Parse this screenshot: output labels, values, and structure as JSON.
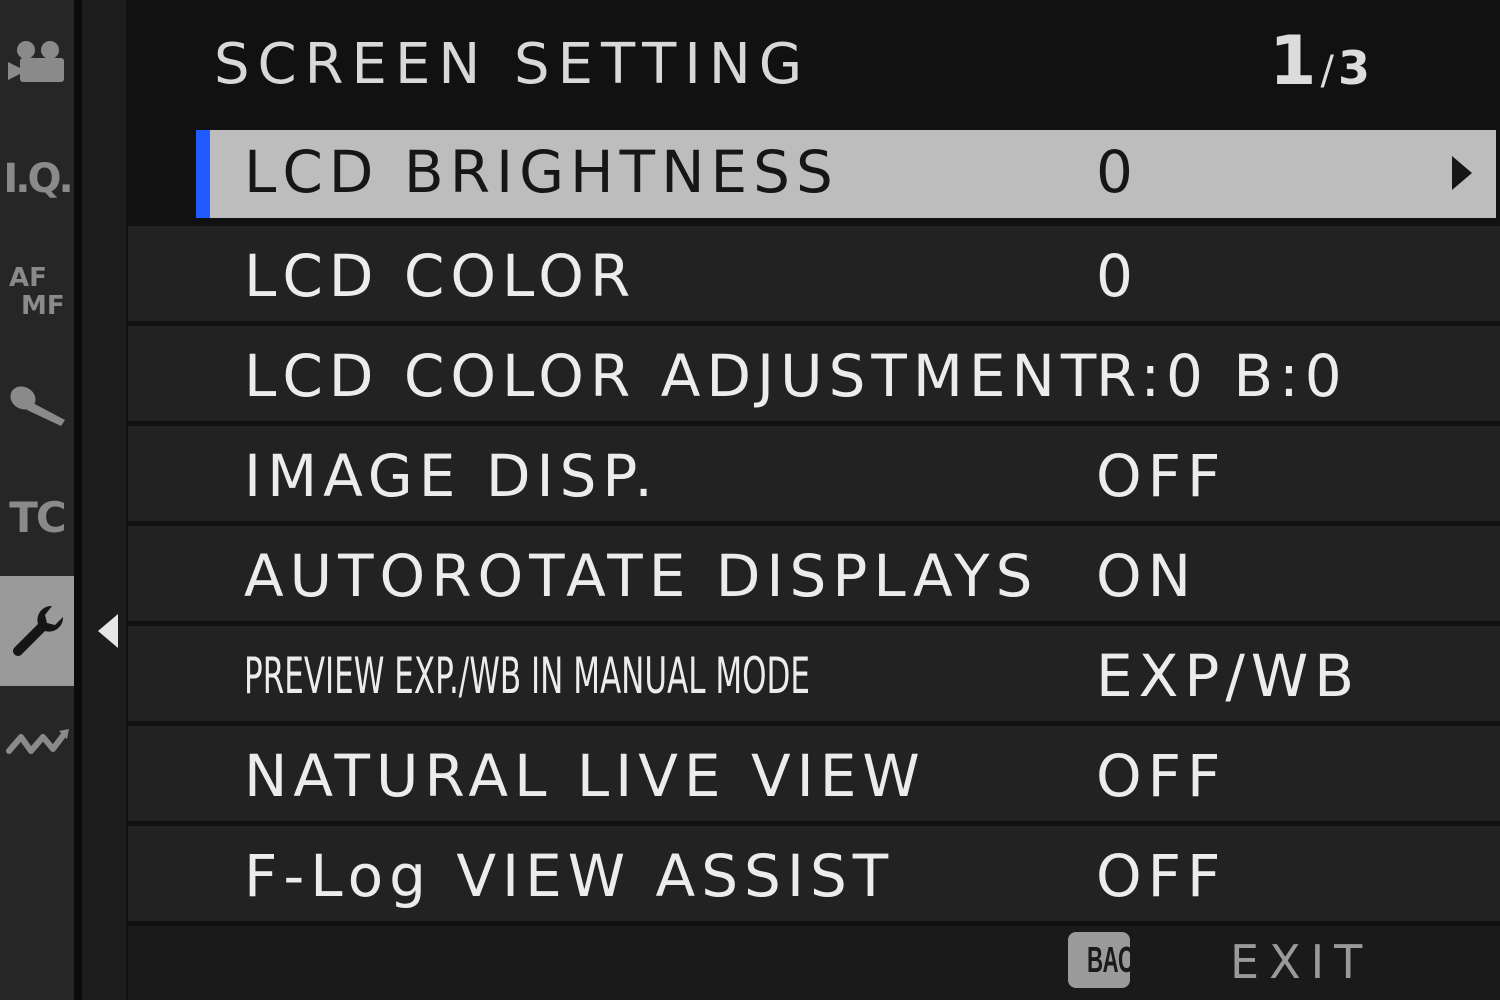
{
  "sidebar": {
    "items": [
      {
        "icon": "movie-camera-icon",
        "text": ""
      },
      {
        "icon": "image-quality-icon",
        "text": "I.Q."
      },
      {
        "icon": "focus-mode-icon",
        "text_top": "AF",
        "text_bottom": "MF"
      },
      {
        "icon": "microphone-icon",
        "text": ""
      },
      {
        "icon": "timecode-icon",
        "text": "TC"
      },
      {
        "icon": "wrench-icon",
        "text": "",
        "active": true
      },
      {
        "icon": "squiggle-icon",
        "text": ""
      }
    ]
  },
  "header": {
    "title": "SCREEN SETTING",
    "page_current": "1",
    "page_separator": "/",
    "page_total": "3"
  },
  "menu": {
    "items": [
      {
        "label": "LCD BRIGHTNESS",
        "value": "0",
        "selected": true
      },
      {
        "label": "LCD COLOR",
        "value": "0"
      },
      {
        "label": "LCD COLOR ADJUSTMENT",
        "value": "R:0 B:0"
      },
      {
        "label": "IMAGE DISP.",
        "value": "OFF"
      },
      {
        "label": "AUTOROTATE DISPLAYS",
        "value": "ON"
      },
      {
        "label": "PREVIEW EXP./WB IN MANUAL MODE",
        "value": "EXP/WB"
      },
      {
        "label": "NATURAL LIVE VIEW",
        "value": "OFF"
      },
      {
        "label": "F-Log VIEW ASSIST",
        "value": "OFF"
      }
    ]
  },
  "footer": {
    "back_badge": "BACK",
    "exit_label": "EXIT"
  },
  "colors": {
    "selection_accent": "#1f5bff",
    "selection_background": "#bdbdbd",
    "row_background": "#222222",
    "text": "#ececec"
  }
}
